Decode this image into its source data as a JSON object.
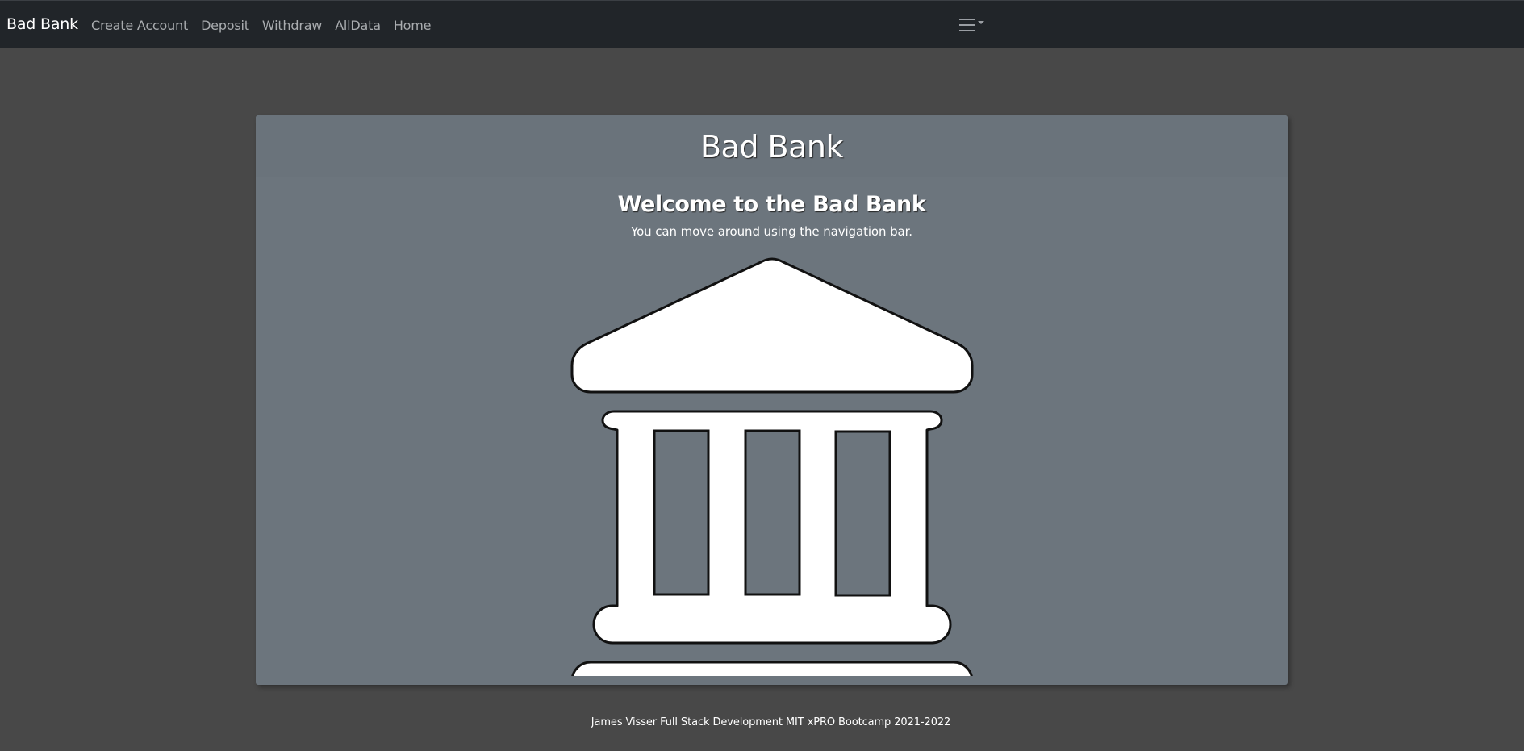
{
  "navbar": {
    "brand": "Bad Bank",
    "links": [
      {
        "label": "Create Account"
      },
      {
        "label": "Deposit"
      },
      {
        "label": "Withdraw"
      },
      {
        "label": "AllData"
      },
      {
        "label": "Home"
      }
    ],
    "toggler_icon": "hamburger-menu-icon"
  },
  "card": {
    "header": "Bad Bank",
    "welcome_title": "Welcome to the Bad Bank",
    "welcome_text": "You can move around using the navigation bar.",
    "image_icon": "bank-building-icon"
  },
  "footer": {
    "text": "James Visser Full Stack Development MIT xPRO Bootcamp 2021-2022"
  },
  "colors": {
    "page_background": "#484848",
    "navbar_background": "#212529",
    "card_background": "#6c757d",
    "text": "#ffffff"
  }
}
